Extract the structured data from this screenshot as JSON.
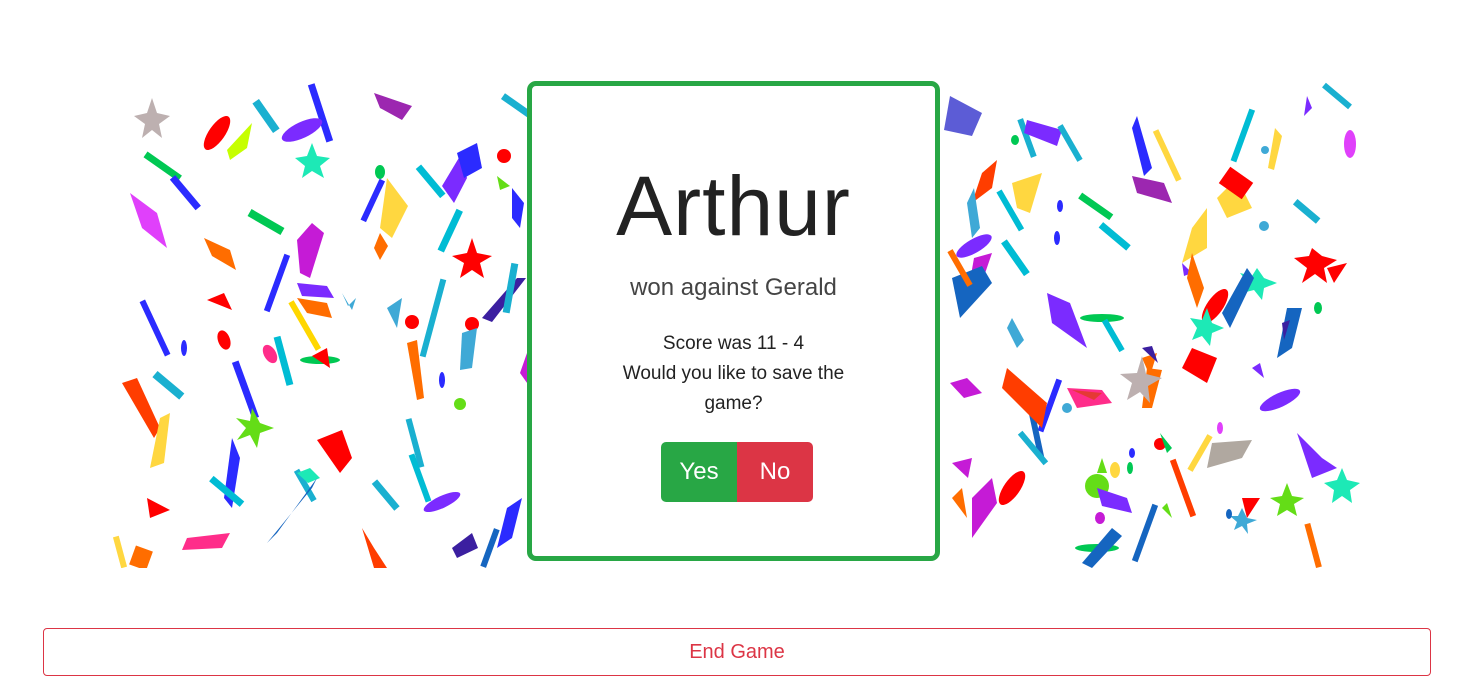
{
  "winner": {
    "name": "Arthur",
    "subtitle": "won against Gerald"
  },
  "score": {
    "text": "Score was 11 - 4",
    "prompt": "Would you like to save the game?"
  },
  "buttons": {
    "yes_label": "Yes",
    "no_label": "No",
    "end_game_label": "End Game"
  },
  "colors": {
    "success": "#28a745",
    "danger": "#dc3545",
    "confetti_palette": [
      "#ff0000",
      "#2b2bff",
      "#7b2bff",
      "#00c853",
      "#ff8c00",
      "#ffd700",
      "#00bcd4",
      "#e040fb",
      "#c2185b",
      "#2ecc71",
      "#ff6f00",
      "#1565c0"
    ]
  }
}
